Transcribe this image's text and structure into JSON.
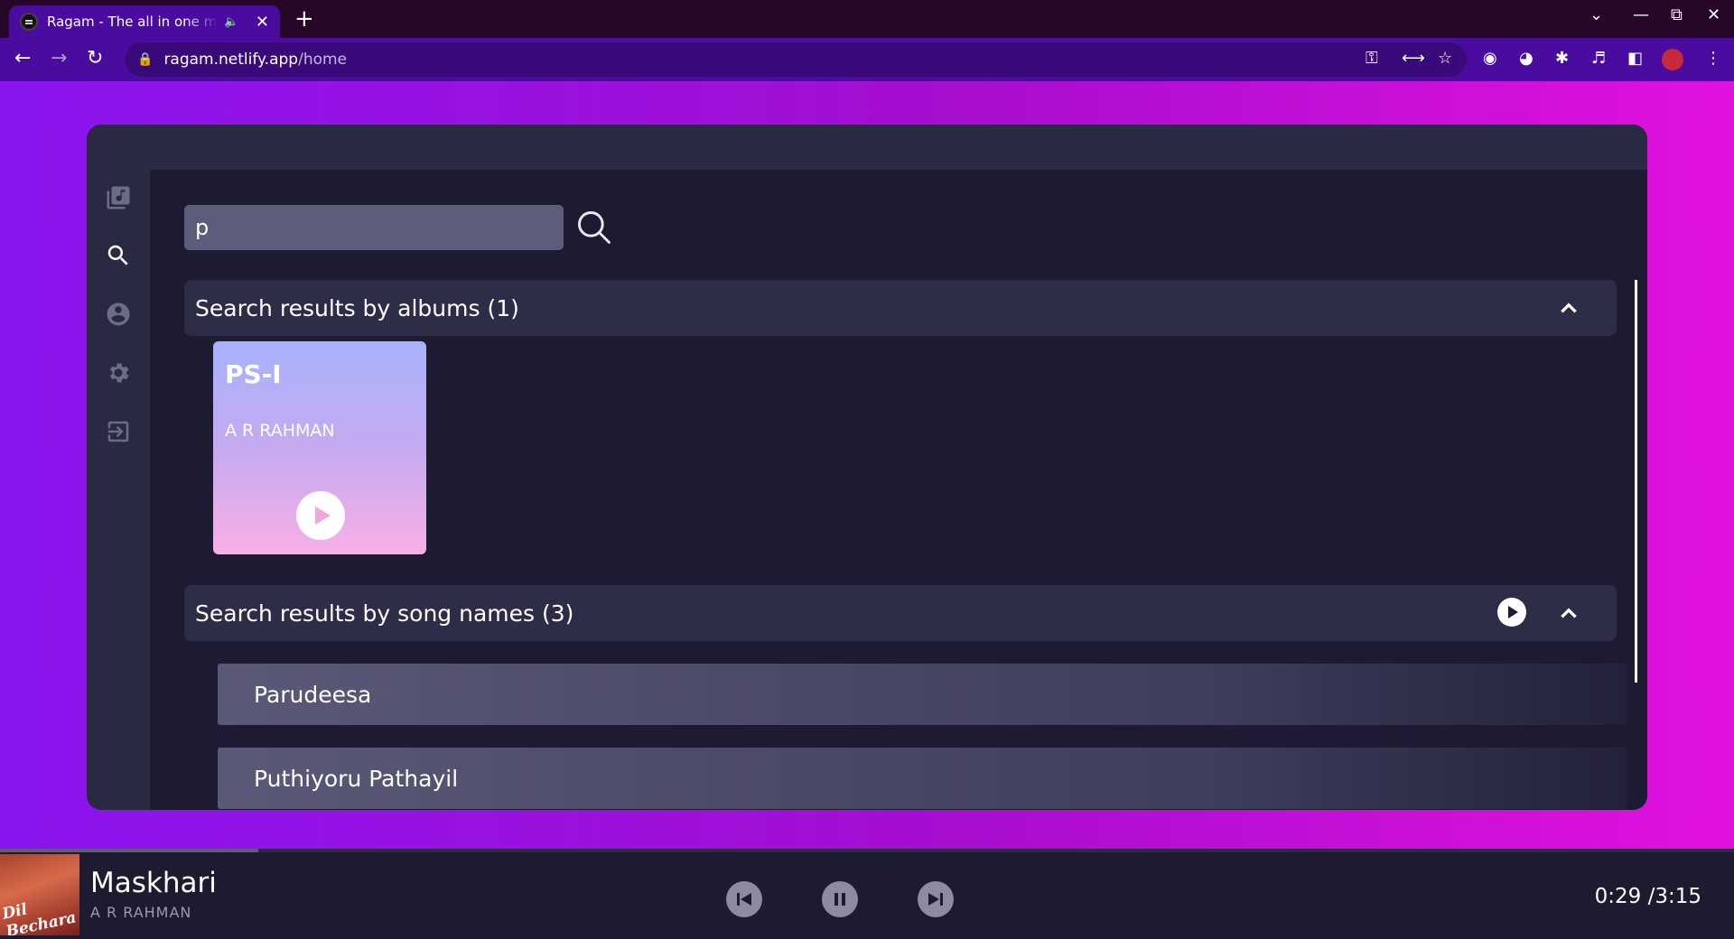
{
  "browser": {
    "tab_title": "Ragam - The all in one music",
    "url_host": "ragam.netlify.app",
    "url_path": "/home"
  },
  "sidebar": {
    "items": [
      {
        "icon": "library-music-icon"
      },
      {
        "icon": "search-icon"
      },
      {
        "icon": "account-circle-icon"
      },
      {
        "icon": "gear-icon"
      },
      {
        "icon": "logout-icon"
      }
    ]
  },
  "search": {
    "value": "p"
  },
  "albums_section": {
    "label": "Search results by albums (1)",
    "albums": [
      {
        "title": "PS-I",
        "artist": "A R RAHMAN"
      }
    ]
  },
  "songs_section": {
    "label": "Search results by song names (3)",
    "songs": [
      {
        "name": "Parudeesa"
      },
      {
        "name": "Puthiyoru Pathayil"
      }
    ]
  },
  "player": {
    "title": "Maskhari",
    "artist": "A R RAHMAN",
    "cover_text": "Dil Bechara",
    "time": "0:29 /3:15",
    "progress": 0.149
  },
  "colors": {
    "accent_purple": "#4a0c9e",
    "panel": "#1c1b32"
  }
}
